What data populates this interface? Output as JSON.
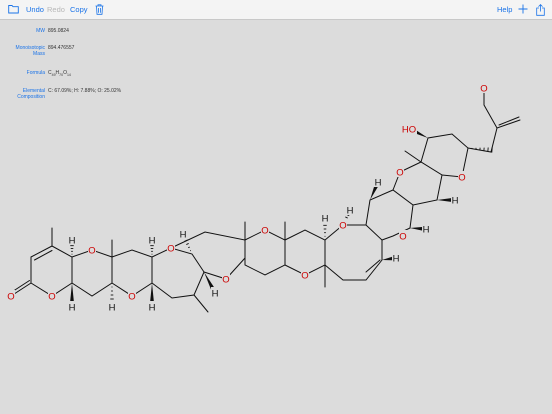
{
  "toolbar": {
    "undo_label": "Undo",
    "redo_label": "Redo",
    "copy_label": "Copy",
    "help_label": "Help",
    "icons": {
      "folder": "folder-icon",
      "trash": "trash-icon",
      "add": "plus-icon",
      "share": "share-icon"
    }
  },
  "properties": {
    "mw_label": "MW",
    "mw_value": "895.0824",
    "mono_label_line1": "Monoisotopic",
    "mono_label_line2": "Mass",
    "mono_value": "894.476557",
    "formula_label": "Formula",
    "formula_c": "C",
    "formula_c_count": "49",
    "formula_h": "H",
    "formula_h_count": "70",
    "formula_o": "O",
    "formula_o_count": "14",
    "elemental_label_line1": "Elemental",
    "elemental_label_line2": "Composition",
    "elemental_value": "C: 67.09%; H: 7.88%; O: 25.02%"
  },
  "atoms": {
    "oxygen": "O",
    "hydrogen": "H",
    "hydroxyl": "HO"
  },
  "colors": {
    "accent": "#1a73e8",
    "oxygen": "#cc0000",
    "bond": "#111111",
    "canvas": "#dcdcdc"
  }
}
